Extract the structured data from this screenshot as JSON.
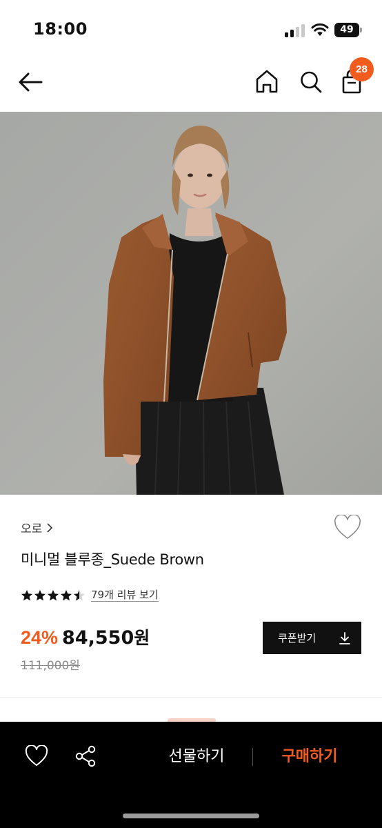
{
  "status_bar": {
    "time": "18:00",
    "battery_level": "49"
  },
  "header": {
    "cart_count": "28",
    "icons": [
      "back-arrow-icon",
      "home-icon",
      "search-icon",
      "shopping-bag-icon"
    ]
  },
  "product": {
    "brand": "오로",
    "name": "미니멀 블루종_Suede Brown",
    "rating": 4.5,
    "rating_max": 5,
    "review_link": "79개 리뷰 보기",
    "discount": "24%",
    "price": "84,550",
    "price_unit": "원",
    "original_price": "111,000원",
    "coupon_label": "쿠폰받기"
  },
  "bottom_bar": {
    "gift_label": "선물하기",
    "buy_label": "구매하기",
    "icons": [
      "heart-icon",
      "share-icon"
    ]
  },
  "colors": {
    "accent": "#f25c1f",
    "jacket": "#94552d",
    "background_wall": "#a9aaa6"
  }
}
